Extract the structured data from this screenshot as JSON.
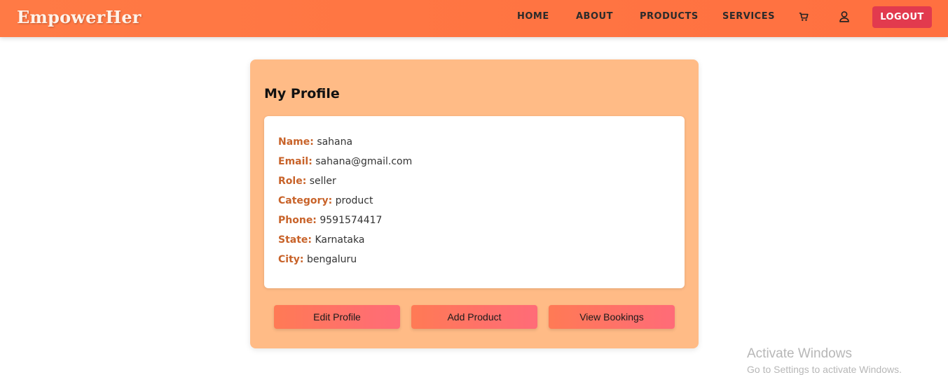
{
  "nav": {
    "brand": "EmpowerHer",
    "links": [
      "HOME",
      "ABOUT",
      "PRODUCTS",
      "SERVICES"
    ],
    "cart_icon": "cart-icon",
    "user_icon": "user-icon",
    "logout_label": "LOGOUT",
    "accent_color": "#ff7a45",
    "logout_color": "#e23a4e"
  },
  "profile": {
    "title": "My Profile",
    "fields": [
      {
        "label": "Name:",
        "value": "sahana"
      },
      {
        "label": "Email:",
        "value": "sahana@gmail.com"
      },
      {
        "label": "Role:",
        "value": "seller"
      },
      {
        "label": "Category:",
        "value": "product"
      },
      {
        "label": "Phone:",
        "value": "9591574417"
      },
      {
        "label": "State:",
        "value": "Karnataka"
      },
      {
        "label": "City:",
        "value": "bengaluru"
      }
    ],
    "buttons": [
      "Edit Profile",
      "Add Product",
      "View Bookings"
    ],
    "card_color": "#ffbb86",
    "label_color": "#c8632a"
  },
  "watermark": {
    "line1": "Activate Windows",
    "line2": "Go to Settings to activate Windows."
  }
}
